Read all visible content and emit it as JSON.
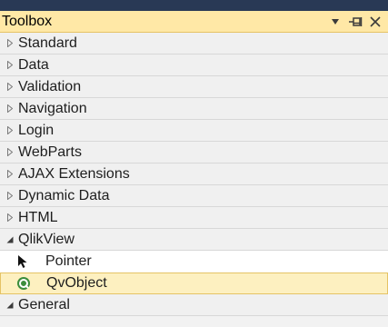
{
  "toolbox": {
    "title": "Toolbox",
    "controls": [
      "dropdown-icon",
      "pin-icon",
      "close-icon"
    ]
  },
  "categories": [
    {
      "label": "Standard",
      "expanded": false
    },
    {
      "label": "Data",
      "expanded": false
    },
    {
      "label": "Validation",
      "expanded": false
    },
    {
      "label": "Navigation",
      "expanded": false
    },
    {
      "label": "Login",
      "expanded": false
    },
    {
      "label": "WebParts",
      "expanded": false
    },
    {
      "label": "AJAX Extensions",
      "expanded": false
    },
    {
      "label": "Dynamic Data",
      "expanded": false
    },
    {
      "label": "HTML",
      "expanded": false
    },
    {
      "label": "QlikView",
      "expanded": true
    }
  ],
  "qlikview_items": [
    {
      "label": "Pointer",
      "icon": "pointer-icon",
      "selected": false
    },
    {
      "label": "QvObject",
      "icon": "qvobject-icon",
      "selected": true
    }
  ],
  "general": {
    "label": "General",
    "expanded": true
  },
  "colors": {
    "titlebar": "#ffe8a6",
    "selected": "#fdf0c0",
    "selected_border": "#e5c365",
    "frame": "#293955"
  }
}
